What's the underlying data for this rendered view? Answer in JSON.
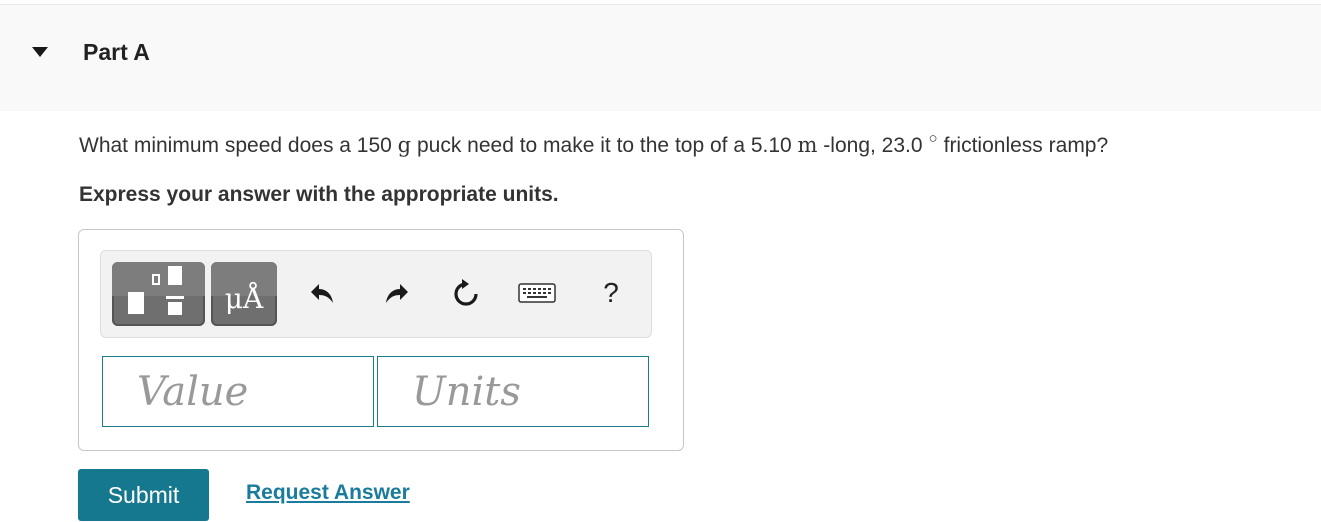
{
  "part": {
    "title": "Part A",
    "caret_icon": "caret-down-icon"
  },
  "question": {
    "text_1": "What minimum speed does a 150 ",
    "mass_unit": "g",
    "text_2": " puck need to make it to the top of a 5.10 ",
    "length_unit": "m",
    "text_3": " -long, 23.0",
    "degree_symbol": "○",
    "text_4": "frictionless ramp?"
  },
  "instruction": "Express your answer with the appropriate units.",
  "toolbar": {
    "template_icon": "fraction-template-icon",
    "units_label": "μÅ",
    "undo_icon": "undo-icon",
    "redo_icon": "redo-icon",
    "reset_icon": "reset-icon",
    "keyboard_icon": "keyboard-icon",
    "help_label": "?"
  },
  "inputs": {
    "value_placeholder": "Value",
    "units_placeholder": "Units"
  },
  "actions": {
    "submit_label": "Submit",
    "request_answer_label": "Request Answer"
  },
  "colors": {
    "accent": "#15788f",
    "link": "#1a7c9c",
    "input_border": "#1a7c8c",
    "header_bg": "#f9f9f9"
  }
}
